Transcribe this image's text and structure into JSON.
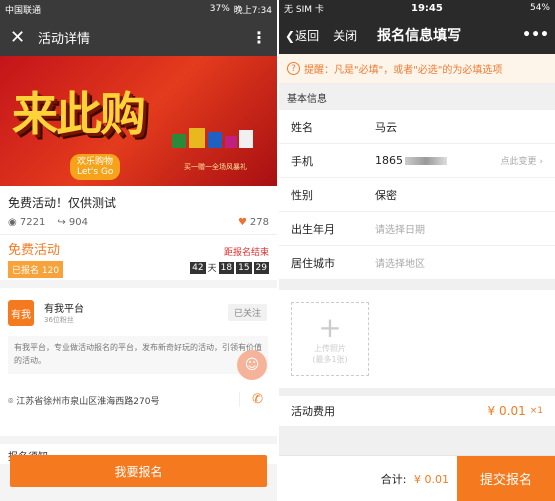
{
  "left": {
    "status": {
      "carrier": "中国联通",
      "battery": "37%",
      "time": "晚上7:34"
    },
    "nav": {
      "close_icon": "close-icon",
      "title": "活动详情",
      "more": "⋮"
    },
    "banner": {
      "headline": "来此购",
      "badge_line1": "欢乐购物",
      "badge_line2": "Let's Go",
      "subtext": "买一赠一全场风暴礼"
    },
    "info": {
      "name": "免费活动！仅供测试",
      "views": "7221",
      "shares": "904",
      "likes": "278"
    },
    "free": {
      "label": "免费活动",
      "signed": "已报名 120",
      "deadline": "距报名结束",
      "days": "42",
      "day_unit": "天",
      "hours": "18",
      "minutes": "15",
      "seconds": "29"
    },
    "org": {
      "logo_text": "有我",
      "name": "有我平台",
      "fans": "36位粉丝",
      "follow": "已关注",
      "description": "有我平台，专业做活动报名的平台，发布新奇好玩的活动，引领有价值的活动。",
      "address": "江苏省徐州市泉山区淮海西路270号"
    },
    "notice": "报名须知",
    "signup_button": "我要报名"
  },
  "right": {
    "status": {
      "carrier": "无 SIM 卡",
      "time": "19:45",
      "battery": "54%"
    },
    "nav": {
      "back": "返回",
      "close": "关闭",
      "title": "报名信息填写",
      "more": "•••"
    },
    "tip": "提醒：凡是\"必填\"，或者\"必选\"的为必填选项",
    "section": "基本信息",
    "fields": [
      {
        "label": "姓名",
        "value": "马云"
      },
      {
        "label": "手机",
        "value": "1865",
        "action": "点此变更"
      },
      {
        "label": "性别",
        "value": "保密"
      },
      {
        "label": "出生年月",
        "placeholder": "请选择日期"
      },
      {
        "label": "居住城市",
        "placeholder": "请选择地区"
      }
    ],
    "photo": {
      "line1": "上传照片",
      "line2": "(最多1张)"
    },
    "fee": {
      "label": "活动费用",
      "price": "¥ 0.01",
      "qty": "×1"
    },
    "bottom": {
      "total_label": "合计:",
      "total": "¥ 0.01",
      "submit": "提交报名"
    }
  }
}
